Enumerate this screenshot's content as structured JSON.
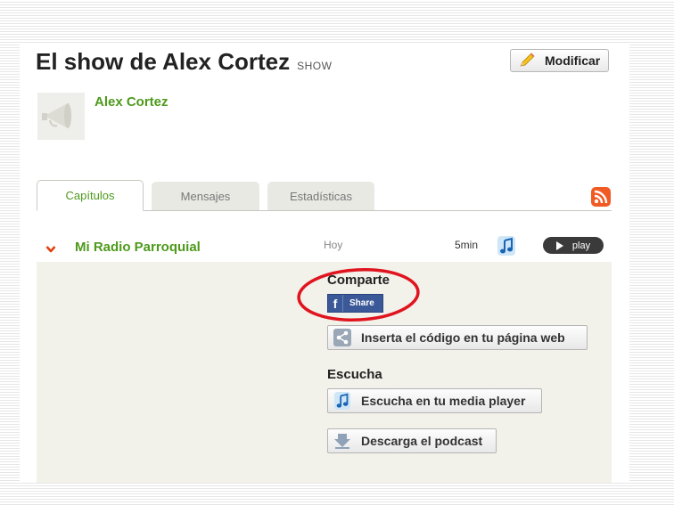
{
  "show": {
    "title": "El show de Alex Cortez",
    "type_tag": "SHOW",
    "edit_label": "Modificar",
    "owner": "Alex Cortez"
  },
  "tabs": [
    {
      "label": "Capítulos",
      "active": true
    },
    {
      "label": "Mensajes",
      "active": false
    },
    {
      "label": "Estadísticas",
      "active": false
    }
  ],
  "episode": {
    "title": "Mi Radio Parroquial",
    "date": "Hoy",
    "duration": "5min",
    "play_label": "play",
    "share_heading": "Comparte",
    "facebook_share": "Share",
    "embed_label": "Inserta el código en tu página web",
    "listen_heading": "Escucha",
    "media_player_label": "Escucha en tu media player",
    "download_label": "Descarga el podcast"
  },
  "colors": {
    "accent_green": "#4d9a1b",
    "facebook_blue": "#3b5998",
    "rss_orange": "#f15a22",
    "annotation_red": "#e0141e"
  },
  "icons": {
    "edit": "pencil-icon",
    "avatar": "megaphone-icon",
    "feed": "rss-icon",
    "collapse": "chevron-down-icon",
    "music": "music-note-icon",
    "embed": "share-nodes-icon",
    "download": "download-arrow-icon"
  }
}
